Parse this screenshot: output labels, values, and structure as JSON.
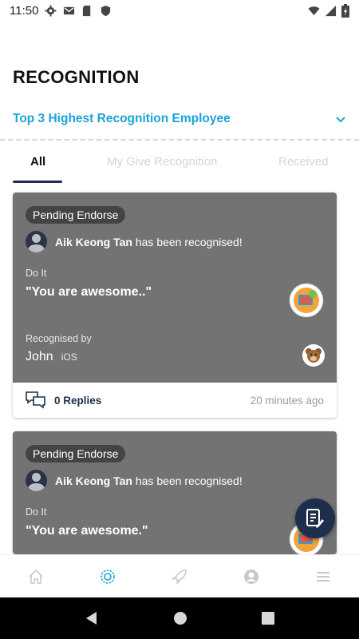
{
  "status_bar": {
    "time": "11:50"
  },
  "page": {
    "title": "RECOGNITION"
  },
  "top3": {
    "label": "Top 3 Highest Recognition Employee"
  },
  "tabs": [
    {
      "label": "All",
      "active": true
    },
    {
      "label": "My Give Recognition",
      "active": false
    },
    {
      "label": "Received",
      "active": false
    }
  ],
  "cards": [
    {
      "badge": "Pending Endorse",
      "user_name": "Aik Keong Tan",
      "user_suffix": "has been recognised!",
      "category": "Do It",
      "message": "\"You are awesome..\"",
      "recognised_by_label": "Recognised by",
      "giver": "John",
      "platform": "iOS",
      "replies": "0 Replies",
      "time_ago": "20 minutes ago"
    },
    {
      "badge": "Pending Endorse",
      "user_name": "Aik Keong Tan",
      "user_suffix": "has been recognised!",
      "category": "Do It",
      "message": "\"You are awesome.\""
    }
  ],
  "colors": {
    "accent": "#1ba3d6",
    "navy": "#1e2f4d",
    "card_bg": "#737373",
    "badge_bg": "#444444"
  },
  "icons": {
    "status": [
      "gear-icon",
      "mail-icon",
      "sd-card-icon",
      "shield-icon",
      "wifi-icon",
      "signal-icon",
      "battery-icon"
    ],
    "bottom_nav": [
      "home-icon",
      "recognition-icon",
      "rocket-icon",
      "profile-icon",
      "menu-icon"
    ],
    "fab": "compose-icon"
  }
}
